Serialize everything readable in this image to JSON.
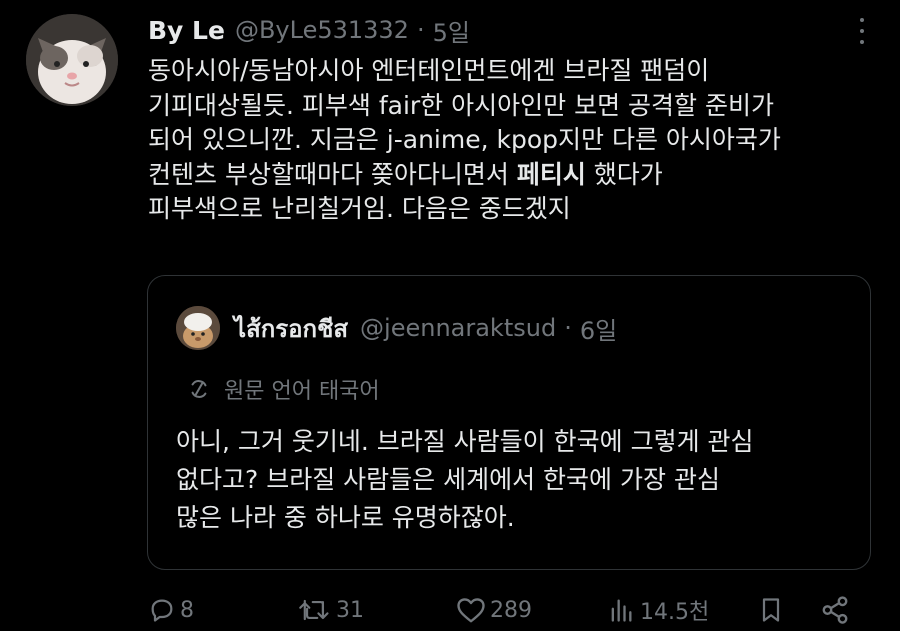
{
  "tweet": {
    "display_name": "By Le",
    "handle": "@ByLe531332",
    "separator": "·",
    "time": "5일",
    "body": {
      "line1": "동아시아/동남아시아 엔터테인먼트에겐 브라질 팬덤이",
      "line2": "기피대상될듯. 피부색 fair한 아시아인만 보면 공격할 준비가",
      "line3": "되어 있으니깐. 지금은 j-anime, kpop지만 다른 아시아국가",
      "line4_pre": "컨텐츠 부상할때마다 쫒아다니면서 ",
      "line4_bold": "페티시",
      "line4_post": " 했다가",
      "line5": "피부색으로 난리칠거임. 다음은 중드겠지"
    }
  },
  "quote": {
    "display_name": "ไส้กรอกชีส",
    "handle": "@jeennaraktsud",
    "separator": "·",
    "time": "6일",
    "translate_label": "원문 언어 태국어",
    "body": {
      "line1": "아니, 그거 웃기네. 브라질 사람들이 한국에 그렇게 관심",
      "line2": "없다고? 브라질 사람들은 세계에서 한국에 가장 관심",
      "line3": "많은 나라 중 하나로 유명하잖아."
    }
  },
  "actions": {
    "replies": "8",
    "reposts": "31",
    "likes": "289",
    "views": "14.5천"
  },
  "colors": {
    "background": "#000000",
    "text": "#e7e9ea",
    "muted": "#71767b",
    "border": "#2f3336"
  }
}
